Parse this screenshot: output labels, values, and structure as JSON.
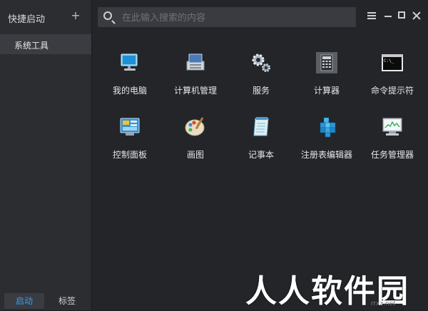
{
  "sidebar": {
    "title": "快捷启动",
    "add_label": "+",
    "items": [
      {
        "label": "系统工具"
      }
    ],
    "bottom_tabs": [
      {
        "label": "启动"
      },
      {
        "label": "标签"
      }
    ]
  },
  "search": {
    "placeholder": "在此输入搜索的内容"
  },
  "tools": [
    {
      "label": "我的电脑",
      "icon": "computer-icon"
    },
    {
      "label": "计算机管理",
      "icon": "computer-management-icon"
    },
    {
      "label": "服务",
      "icon": "services-gear-icon"
    },
    {
      "label": "计算器",
      "icon": "calculator-icon"
    },
    {
      "label": "命令提示符",
      "icon": "command-prompt-icon"
    },
    {
      "label": "控制面板",
      "icon": "control-panel-icon"
    },
    {
      "label": "画图",
      "icon": "paint-palette-icon"
    },
    {
      "label": "记事本",
      "icon": "notepad-icon"
    },
    {
      "label": "注册表编辑器",
      "icon": "registry-editor-icon"
    },
    {
      "label": "任务管理器",
      "icon": "task-manager-icon"
    }
  ],
  "watermark": {
    "text": "人人软件园",
    "sub": "rrxz.net"
  },
  "colors": {
    "accent": "#3b9bf0",
    "background": "#232529",
    "sidebar": "#2b2d31"
  }
}
